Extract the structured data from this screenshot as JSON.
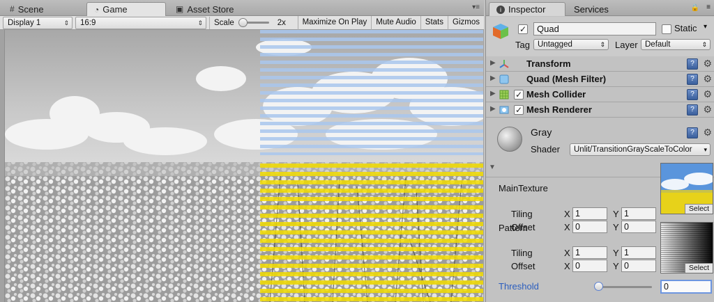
{
  "left_pane": {
    "tabs": [
      {
        "label": "Scene",
        "icon": "grid-icon"
      },
      {
        "label": "Game",
        "icon": "pacman-icon"
      },
      {
        "label": "Asset Store",
        "icon": "store-bag-icon"
      }
    ],
    "toolbar": {
      "display": "Display 1",
      "aspect": "16:9",
      "scale_label": "Scale",
      "scale_value": "2x",
      "buttons": [
        "Maximize On Play",
        "Mute Audio",
        "Stats",
        "Gizmos"
      ]
    }
  },
  "inspector": {
    "tabs": [
      "Inspector",
      "Services"
    ],
    "object": {
      "active": true,
      "name": "Quad",
      "static_label": "Static",
      "static_checked": false,
      "tag_label": "Tag",
      "tag_value": "Untagged",
      "layer_label": "Layer",
      "layer_value": "Default"
    },
    "components": [
      {
        "name": "Transform",
        "icon": "transform-icon",
        "has_checkbox": false
      },
      {
        "name": "Quad (Mesh Filter)",
        "icon": "mesh-filter-icon",
        "has_checkbox": false
      },
      {
        "name": "Mesh Collider",
        "icon": "mesh-collider-icon",
        "has_checkbox": true,
        "checked": true
      },
      {
        "name": "Mesh Renderer",
        "icon": "mesh-renderer-icon",
        "has_checkbox": true,
        "checked": true
      }
    ],
    "material": {
      "name": "Gray",
      "shader_label": "Shader",
      "shader_value": "Unlit/TransitionGrayScaleToColor"
    },
    "properties": {
      "main_texture": {
        "label": "MainTexture",
        "tiling_label": "Tiling",
        "tiling_x": "1",
        "tiling_y": "1",
        "offset_label": "Offset",
        "offset_x": "0",
        "offset_y": "0",
        "select_label": "Select"
      },
      "pattern": {
        "label": "Pattern",
        "tiling_label": "Tiling",
        "tiling_x": "1",
        "tiling_y": "1",
        "offset_label": "Offset",
        "offset_x": "0",
        "offset_y": "0",
        "select_label": "Select"
      },
      "threshold": {
        "label": "Threshold",
        "value": "0",
        "fraction": 0
      }
    },
    "axis_labels": {
      "x": "X",
      "y": "Y"
    }
  },
  "colors": {
    "highlight_yellow": "#f2dc00",
    "highlight_blue": "#a9c7ee",
    "threshold_label": "#2a5dbe",
    "help_button": "#4a6ea8"
  }
}
